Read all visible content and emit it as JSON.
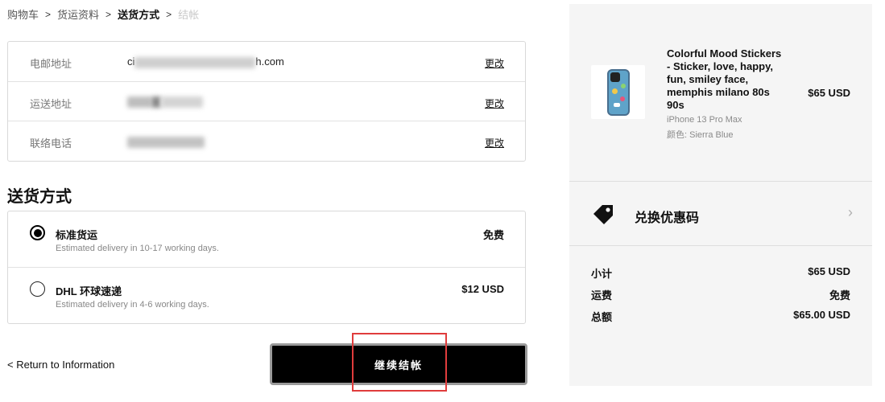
{
  "breadcrumb": {
    "items": [
      "购物车",
      "货运资料",
      "送货方式",
      "结帐"
    ],
    "separator": ">"
  },
  "contact": {
    "email": {
      "label": "电邮地址",
      "value": "ci",
      "value_tail": "h.com",
      "change": "更改"
    },
    "address": {
      "label": "运送地址",
      "value": "",
      "change": "更改"
    },
    "phone": {
      "label": "联络电话",
      "value": "",
      "change": "更改"
    }
  },
  "shipping": {
    "title": "送货方式",
    "options": [
      {
        "name": "标准货运",
        "desc": "Estimated delivery in 10-17 working days.",
        "price": "免费",
        "selected": true
      },
      {
        "name": "DHL 环球速递",
        "desc": "Estimated delivery in 4-6 working days.",
        "price": "$12 USD",
        "selected": false
      }
    ]
  },
  "actions": {
    "return_label": "< Return to Information",
    "continue_label": "继续结帐"
  },
  "summary": {
    "product": {
      "title": "Colorful Mood Stickers - Sticker, love, happy, fun, smiley face, memphis milano 80s 90s",
      "variant": "iPhone 13 Pro Max",
      "color": "颜色: Sierra Blue",
      "price": "$65 USD"
    },
    "coupon_label": "兑换优惠码",
    "totals": [
      {
        "label": "小计",
        "value": "$65 USD"
      },
      {
        "label": "运费",
        "value": "免费"
      },
      {
        "label": "总额",
        "value": "$65.00 USD"
      }
    ]
  },
  "colors": {
    "highlight": "#e03c3c",
    "button_bg": "#000000",
    "panel_bg": "#f5f5f5"
  }
}
